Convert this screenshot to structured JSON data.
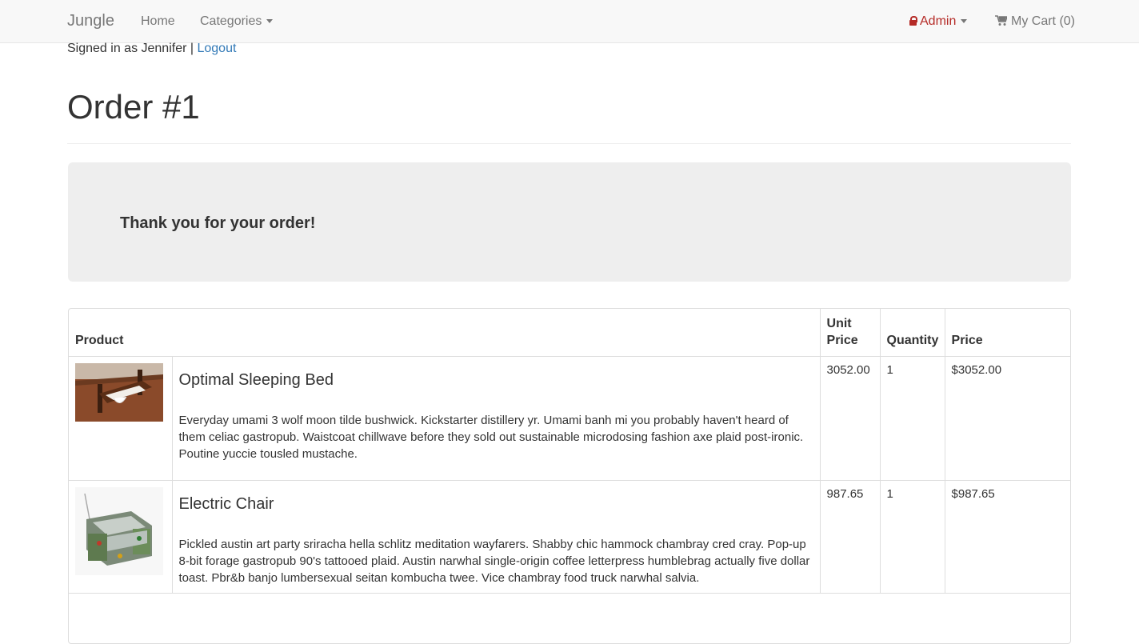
{
  "navbar": {
    "brand": "Jungle",
    "home": "Home",
    "categories": "Categories",
    "admin": "Admin",
    "cart": "My Cart (0)"
  },
  "session": {
    "signed_in": "Signed in as Jennifer |",
    "logout": "Logout"
  },
  "page": {
    "title": "Order #1",
    "thank_you": "Thank you for your order!"
  },
  "table": {
    "headers": {
      "product": "Product",
      "unit_price": "Unit Price",
      "quantity": "Quantity",
      "price": "Price"
    },
    "rows": [
      {
        "name": "Optimal Sleeping Bed",
        "description": "Everyday umami 3 wolf moon tilde bushwick. Kickstarter distillery yr. Umami banh mi you probably haven't heard of them celiac gastropub. Waistcoat chillwave before they sold out sustainable microdosing fashion axe plaid post-ironic. Poutine yuccie tousled mustache.",
        "unit_price": "3052.00",
        "quantity": "1",
        "price": "$3052.00"
      },
      {
        "name": "Electric Chair",
        "description": "Pickled austin art party sriracha hella schlitz meditation wayfarers. Shabby chic hammock chambray cred cray. Pop-up 8-bit forage gastropub 90's tattooed plaid. Austin narwhal single-origin coffee letterpress humblebrag actually five dollar toast. Pbr&b banjo lumbersexual seitan kombucha twee. Vice chambray food truck narwhal salvia.",
        "unit_price": "987.65",
        "quantity": "1",
        "price": "$987.65"
      }
    ]
  },
  "colors": {
    "navbar_bg": "#f8f8f8",
    "admin": "#b52b27",
    "link": "#337ab7",
    "jumbotron_bg": "#eeeeee"
  }
}
